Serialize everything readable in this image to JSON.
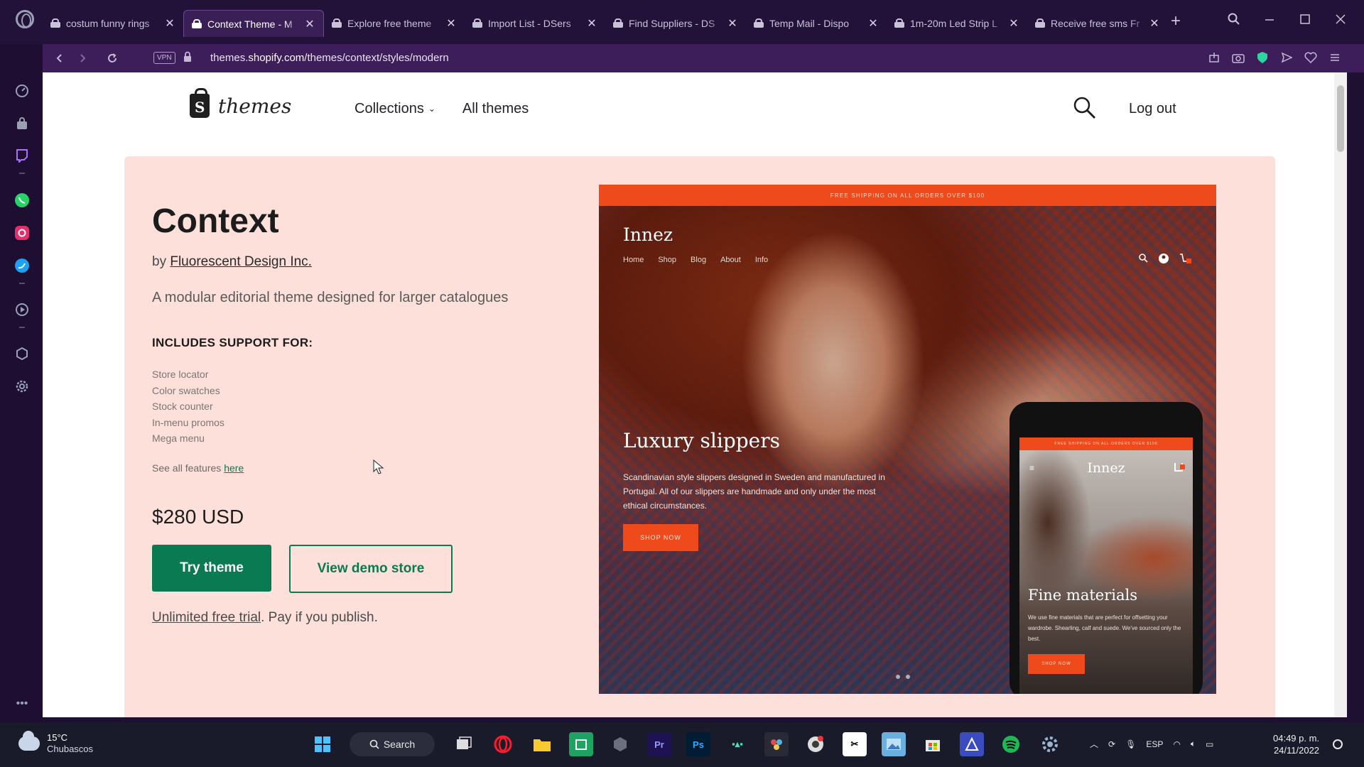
{
  "browser": {
    "tabs": [
      {
        "title": "costum funny rings",
        "active": false
      },
      {
        "title": "Context Theme - M",
        "active": true
      },
      {
        "title": "Explore free theme",
        "active": false
      },
      {
        "title": "Import List - DSers",
        "active": false
      },
      {
        "title": "Find Suppliers - DS",
        "active": false
      },
      {
        "title": "Temp Mail - Dispo",
        "active": false
      },
      {
        "title": "1m-20m Led Strip L",
        "active": false
      },
      {
        "title": "Receive free sms Fr",
        "active": false
      }
    ],
    "vpn_label": "VPN",
    "url_prefix": "themes.",
    "url_domain": "shopify.com",
    "url_path": "/themes/context/styles/modern"
  },
  "site": {
    "logo_text": "themes",
    "nav": {
      "collections": "Collections",
      "all_themes": "All themes"
    },
    "logout": "Log out"
  },
  "theme": {
    "name": "Context",
    "by": "by",
    "author": "Fluorescent Design Inc.",
    "tagline": "A modular editorial theme designed for larger catalogues",
    "includes_heading": "INCLUDES SUPPORT FOR:",
    "features": [
      "Store locator",
      "Color swatches",
      "Stock counter",
      "In-menu promos",
      "Mega menu"
    ],
    "see_all_prefix": "See all features",
    "see_all_link": "here",
    "price": "$280 USD",
    "try_button": "Try theme",
    "demo_button": "View demo store",
    "trial_link": "Unlimited free trial",
    "trial_suffix": ". Pay if you publish."
  },
  "preview": {
    "banner": "FREE SHIPPING ON ALL ORDERS OVER $100",
    "brand": "Innez",
    "nav": [
      "Home",
      "Shop",
      "Blog",
      "About",
      "Info"
    ],
    "hero_title": "Luxury slippers",
    "hero_desc": "Scandinavian style slippers designed in Sweden and manufactured in Portugal. All of our slippers are handmade and only under the most ethical circumstances.",
    "shop_now": "SHOP NOW",
    "mobile": {
      "banner": "FREE SHIPPING ON ALL ORDERS OVER $100",
      "brand": "Innez",
      "title": "Fine materials",
      "desc": "We use fine materials that are perfect for offsetting your wardrobe. Shearling, calf and suede. We've sourced only the best.",
      "shop_now": "SHOP NOW"
    }
  },
  "taskbar": {
    "temperature": "15°C",
    "condition": "Chubascos",
    "search": "Search",
    "language": "ESP",
    "time": "04:49 p. m.",
    "date": "24/11/2022"
  },
  "colors": {
    "brand_green": "#0a7a52",
    "hero_bg": "#fde0d9",
    "preview_accent": "#ef4a1b",
    "browser_bg": "#22123a"
  }
}
